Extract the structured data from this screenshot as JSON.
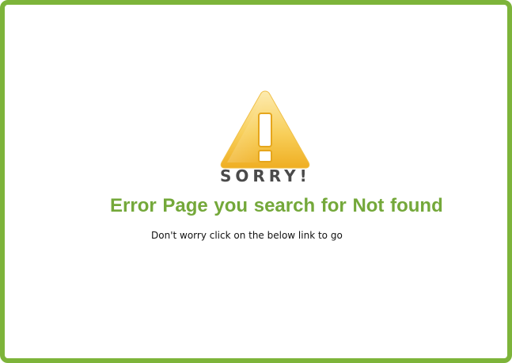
{
  "page": {
    "icon": "warning-icon",
    "heading": "SORRY!",
    "title": "Error Page you search for Not found",
    "subtitle": "Don't worry click on the below link to go"
  },
  "colors": {
    "border": "#7db43a",
    "title": "#74a83a",
    "heading": "#4a4a4a",
    "icon_fill_top": "#fde79a",
    "icon_fill_bottom": "#f2b425"
  }
}
